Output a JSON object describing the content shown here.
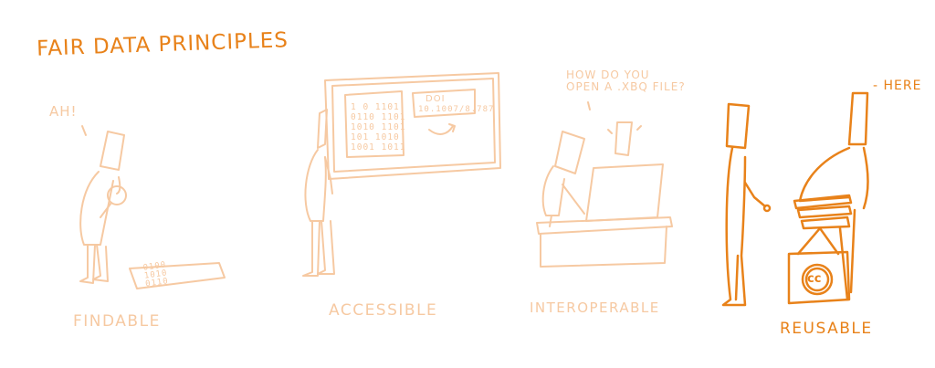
{
  "title": "FAIR DATA PRINCIPLES",
  "colors": {
    "strong": "#E8821A",
    "faded": "#F6C9A2"
  },
  "panels": [
    {
      "label": "FINDABLE",
      "speech": "AH!",
      "paper_bits": [
        "0100",
        "1010",
        "0110"
      ]
    },
    {
      "label": "ACCESSIBLE",
      "board_bits": [
        "1 0 1101",
        "0110 1101",
        "1010 1101",
        "101 1010",
        "1001 1011"
      ],
      "doi_title": "DOI",
      "doi_value": "10.1007/8.787"
    },
    {
      "label": "INTEROPERABLE",
      "speech": "HOW DO YOU\nOPEN A .XBQ FILE?"
    },
    {
      "label": "REUSABLE",
      "speech": "- HERE",
      "badge": "cc"
    }
  ]
}
